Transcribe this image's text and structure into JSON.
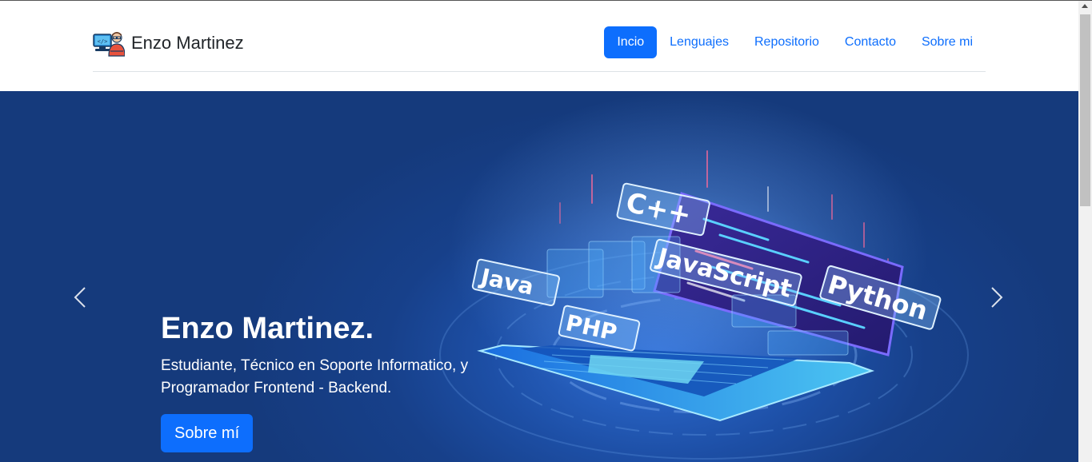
{
  "header": {
    "brand": {
      "name": "Enzo Martinez",
      "icon": "developer-avatar-icon"
    },
    "nav": [
      {
        "label": "Incio",
        "active": true
      },
      {
        "label": "Lenguajes",
        "active": false
      },
      {
        "label": "Repositorio",
        "active": false
      },
      {
        "label": "Contacto",
        "active": false
      },
      {
        "label": "Sobre mi",
        "active": false
      }
    ]
  },
  "hero": {
    "title": "Enzo Martinez.",
    "subtitle": "Estudiante, Técnico en Soporte Informatico, y Programador Frontend - Backend.",
    "button_label": "Sobre mí",
    "image_labels": [
      "C++",
      "JavaScript",
      "Python",
      "Java",
      "PHP"
    ],
    "controls": {
      "prev_icon": "chevron-left-icon",
      "next_icon": "chevron-right-icon"
    }
  },
  "colors": {
    "primary": "#0d6efd",
    "hero_bg": "#1d4fa6",
    "text_dark": "#212529"
  }
}
